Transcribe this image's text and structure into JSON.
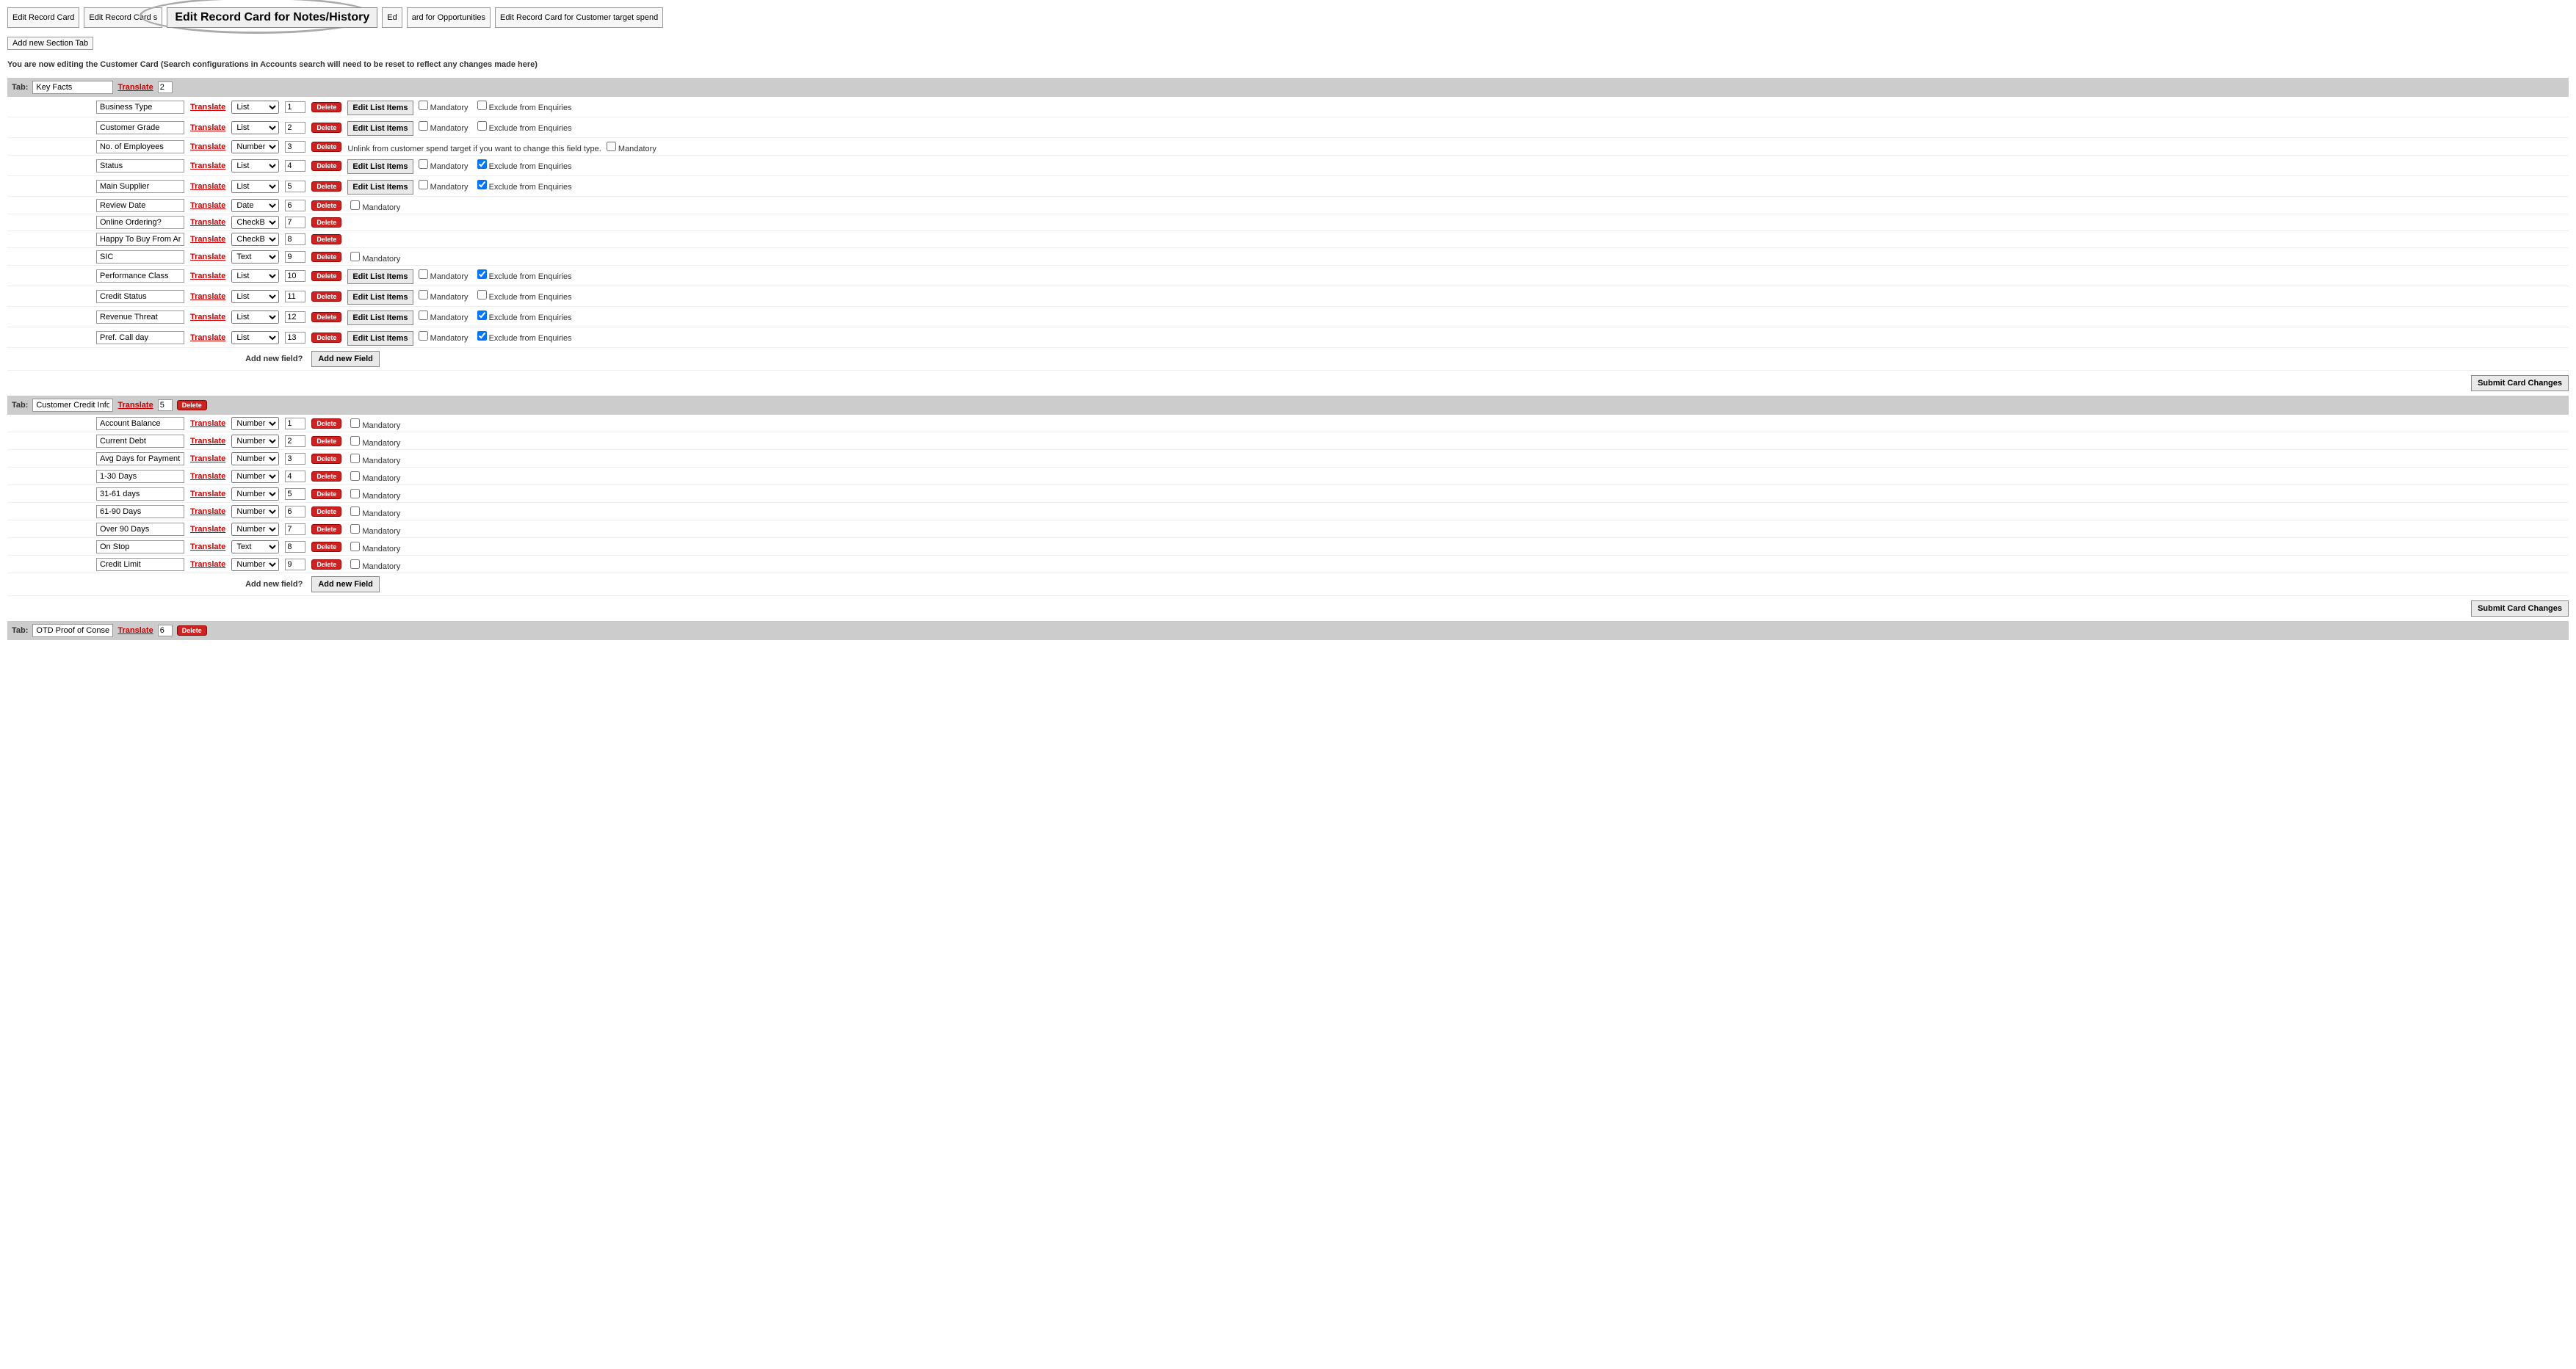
{
  "top_tabs": {
    "edit_card": "Edit Record Card",
    "edit_card_s": "Edit Record Card s",
    "edit_notes": "Edit Record Card for Notes/History",
    "edit_ed": "Ed",
    "edit_opp": "ard for Opportunities",
    "edit_spend": "Edit Record Card for Customer target spend"
  },
  "add_section_tab": "Add new Section Tab",
  "notice": "You are now editing the Customer Card (Search configurations in Accounts search will need to be reset to reflect any changes made here)",
  "labels": {
    "tab": "Tab:",
    "translate": "Translate",
    "delete": "Delete",
    "edit_list": "Edit List Items",
    "mandatory": "Mandatory",
    "exclude": "Exclude from Enquiries",
    "add_new_field": "Add new field?",
    "add_new_field_btn": "Add new Field",
    "submit": "Submit Card Changes",
    "unlink_note": "Unlink from customer spend target if you want to change this field type."
  },
  "field_types": {
    "list": "List",
    "number": "Number",
    "date": "Date",
    "checkbox": "CheckBox",
    "text": "Text"
  },
  "section1": {
    "tab_name": "Key Facts",
    "tab_order": "2",
    "fields": [
      {
        "name": "Business Type",
        "type": "list",
        "order": "1",
        "edit_list": true,
        "mandatory": false,
        "exclude": false,
        "has_exclude": true
      },
      {
        "name": "Customer Grade",
        "type": "list",
        "order": "2",
        "edit_list": true,
        "mandatory": false,
        "exclude": false,
        "has_exclude": true
      },
      {
        "name": "No. of Employees",
        "type": "number",
        "order": "3",
        "edit_list": false,
        "mandatory": false,
        "exclude": null,
        "note": true
      },
      {
        "name": "Status",
        "type": "list",
        "order": "4",
        "edit_list": true,
        "mandatory": false,
        "exclude": true,
        "has_exclude": true
      },
      {
        "name": "Main Supplier",
        "type": "list",
        "order": "5",
        "edit_list": true,
        "mandatory": false,
        "exclude": true,
        "has_exclude": true
      },
      {
        "name": "Review Date",
        "type": "date",
        "order": "6",
        "edit_list": false,
        "mandatory": false,
        "exclude": null
      },
      {
        "name": "Online Ordering?",
        "type": "checkbox",
        "order": "7",
        "edit_list": false,
        "mandatory": null,
        "exclude": null
      },
      {
        "name": "Happy To Buy From An I",
        "type": "checkbox",
        "order": "8",
        "edit_list": false,
        "mandatory": null,
        "exclude": null
      },
      {
        "name": "SIC",
        "type": "text",
        "order": "9",
        "edit_list": false,
        "mandatory": false,
        "exclude": null
      },
      {
        "name": "Performance Class",
        "type": "list",
        "order": "10",
        "edit_list": true,
        "mandatory": false,
        "exclude": true,
        "has_exclude": true
      },
      {
        "name": "Credit Status",
        "type": "list",
        "order": "11",
        "edit_list": true,
        "mandatory": false,
        "exclude": false,
        "has_exclude": true
      },
      {
        "name": "Revenue Threat",
        "type": "list",
        "order": "12",
        "edit_list": true,
        "mandatory": false,
        "exclude": true,
        "has_exclude": true
      },
      {
        "name": "Pref. Call day",
        "type": "list",
        "order": "13",
        "edit_list": true,
        "mandatory": false,
        "exclude": true,
        "has_exclude": true
      }
    ]
  },
  "section2": {
    "tab_name": "Customer Credit Inform",
    "tab_order": "5",
    "has_delete": true,
    "fields": [
      {
        "name": "Account Balance",
        "type": "number",
        "order": "1",
        "mandatory": false
      },
      {
        "name": "Current Debt",
        "type": "number",
        "order": "2",
        "mandatory": false
      },
      {
        "name": "Avg Days for Payment",
        "type": "number",
        "order": "3",
        "mandatory": false
      },
      {
        "name": "1-30 Days",
        "type": "number",
        "order": "4",
        "mandatory": false
      },
      {
        "name": "31-61 days",
        "type": "number",
        "order": "5",
        "mandatory": false
      },
      {
        "name": "61-90 Days",
        "type": "number",
        "order": "6",
        "mandatory": false
      },
      {
        "name": "Over 90 Days",
        "type": "number",
        "order": "7",
        "mandatory": false
      },
      {
        "name": "On Stop",
        "type": "text",
        "order": "8",
        "mandatory": false
      },
      {
        "name": "Credit Limit",
        "type": "number",
        "order": "9",
        "mandatory": false
      }
    ]
  },
  "section3": {
    "tab_name": "OTD Proof of Consent",
    "tab_order": "6",
    "has_delete": true
  }
}
